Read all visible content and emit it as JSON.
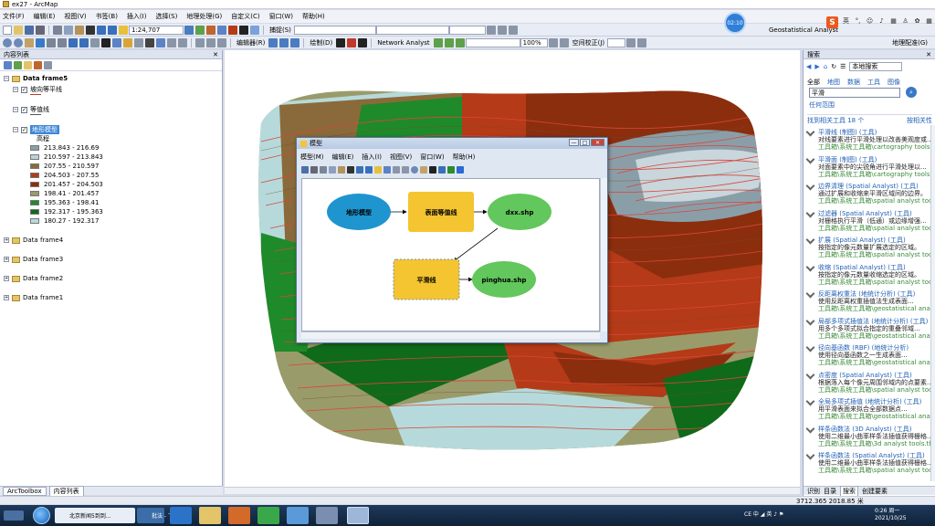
{
  "window": {
    "title": "ex27 - ArcMap"
  },
  "menu": [
    "文件(F)",
    "编辑(E)",
    "视图(V)",
    "书签(B)",
    "插入(I)",
    "选择(S)",
    "地理处理(G)",
    "自定义(C)",
    "窗口(W)",
    "帮助(H)"
  ],
  "toolbar": {
    "scale": "1:24,707",
    "snapping": "捕捉(S)",
    "editor": "编辑器(R)",
    "drawing": "绘制(D)",
    "network_analyst": "Network Analyst",
    "spatial_adjustment": "空间校正(J)",
    "geostatistical": "Geostatistical Analyst",
    "zoom": "100%",
    "georeferencing": "地理配准(G)",
    "timer": "02:10"
  },
  "sogou": {
    "logo": "S",
    "lang": "英"
  },
  "toc": {
    "title": "内容列表",
    "frames": [
      {
        "label": "Data frame5",
        "bold": true
      },
      {
        "label": "Data frame4"
      },
      {
        "label": "Data frame3"
      },
      {
        "label": "Data frame2"
      },
      {
        "label": "Data frame1"
      }
    ],
    "layers": [
      {
        "label": "坡向等平线"
      },
      {
        "label": "等值线"
      },
      {
        "label": "地形模型",
        "selected": true
      }
    ],
    "value_label": "高程",
    "legend": [
      {
        "label": "213.843 - 216.69",
        "color": "#8a9ea8"
      },
      {
        "label": "210.597 - 213.843",
        "color": "#b9d2d9"
      },
      {
        "label": "207.55 - 210.597",
        "color": "#8a6a3a"
      },
      {
        "label": "204.503 - 207.55",
        "color": "#b53a17"
      },
      {
        "label": "201.457 - 204.503",
        "color": "#8b2e0e"
      },
      {
        "label": "198.41 - 201.457",
        "color": "#9a9b6a"
      },
      {
        "label": "195.363 - 198.41",
        "color": "#1f8a2a"
      },
      {
        "label": "192.317 - 195.363",
        "color": "#0f6a1a"
      },
      {
        "label": "180.27 - 192.317",
        "color": "#b6dadb"
      }
    ],
    "bottom_tabs": [
      "ArcToolbox",
      "内容列表"
    ]
  },
  "model": {
    "title": "模型",
    "menu": [
      "模型(M)",
      "编辑(E)",
      "插入(I)",
      "视图(V)",
      "窗口(W)",
      "帮助(H)"
    ],
    "nodes": {
      "input": "地形模型",
      "tool1": "表面等值线",
      "output1": "dxx.shp",
      "tool2": "平滑线",
      "output2": "pinghua.shp"
    },
    "colors": {
      "data": "#1e95cf",
      "tool": "#f4c531",
      "derived": "#62c75c"
    }
  },
  "search": {
    "title": "搜索",
    "scope": "本地搜索",
    "filters": [
      "全部",
      "地图",
      "数据",
      "工具",
      "图像"
    ],
    "query": "平滑",
    "options": "任何范围",
    "summary": "找到相关工具 18 个",
    "sort": "按相关性",
    "results": [
      {
        "title": "平滑线 (制图) (工具)",
        "desc": "对线要素进行平滑处理以改善美观度或...",
        "path": "工具箱\\系统工具箱\\cartography tools.tb..."
      },
      {
        "title": "平滑面 (制图) (工具)",
        "desc": "对面要素中的尖锐角进行平滑处理以...",
        "path": "工具箱\\系统工具箱\\cartography tools.tb..."
      },
      {
        "title": "边界清理 (Spatial Analyst) (工具)",
        "desc": "通过扩展和收缩来平滑区域间的边界。",
        "path": "工具箱\\系统工具箱\\spatial analyst tools..."
      },
      {
        "title": "过滤器 (Spatial Analyst) (工具)",
        "desc": "对栅格执行平滑（低通）或边缘增强...",
        "path": "工具箱\\系统工具箱\\spatial analyst tools..."
      },
      {
        "title": "扩展 (Spatial Analyst) (工具)",
        "desc": "按指定的像元数量扩展选定的区域。",
        "path": "工具箱\\系统工具箱\\spatial analyst tools..."
      },
      {
        "title": "收缩 (Spatial Analyst) (工具)",
        "desc": "按指定的像元数量收缩选定的区域。",
        "path": "工具箱\\系统工具箱\\spatial analyst tools..."
      },
      {
        "title": "反距离权重法 (地统计分析) (工具)",
        "desc": "使用反距离权重插值法生成表面...",
        "path": "工具箱\\系统工具箱\\geostatistical analys..."
      },
      {
        "title": "局部多项式插值法 (地统计分析) (工具)",
        "desc": "用多个多项式拟合指定的重叠邻域...",
        "path": "工具箱\\系统工具箱\\geostatistical analys..."
      },
      {
        "title": "径向基函数 (RBF) (地统计分析)",
        "desc": "使用径向基函数之一生成表面...",
        "path": "工具箱\\系统工具箱\\geostatistical analys..."
      },
      {
        "title": "点密度 (Spatial Analyst) (工具)",
        "desc": "根据落入每个像元周围邻域内的点要素...",
        "path": "工具箱\\系统工具箱\\spatial analyst tools..."
      },
      {
        "title": "全局多项式插值 (地统计分析) (工具)",
        "desc": "用平滑表面来拟合全部数据点...",
        "path": "工具箱\\系统工具箱\\geostatistical analys..."
      },
      {
        "title": "样条函数法 (3D Analyst) (工具)",
        "desc": "使用二维最小曲率样条法插值获得栅格...",
        "path": "工具箱\\系统工具箱\\3d analyst tools.tb..."
      },
      {
        "title": "样条函数法 (Spatial Analyst) (工具)",
        "desc": "使用二维最小曲率样条法插值获得栅格...",
        "path": "工具箱\\系统工具箱\\spatial analyst tools..."
      }
    ],
    "footer": [
      "识别",
      "目录",
      "搜索",
      "创建要素"
    ]
  },
  "status": {
    "coords": "3712.365  2018.85 米"
  },
  "taskbar": {
    "browser_label": "北京新闻5到到...",
    "arcmap_label": "批法 - 下",
    "clock_time": "0:26 周一",
    "clock_date": "2021/10/25",
    "tray": "CE 中 ◢ 英 ♪ ⚑"
  }
}
